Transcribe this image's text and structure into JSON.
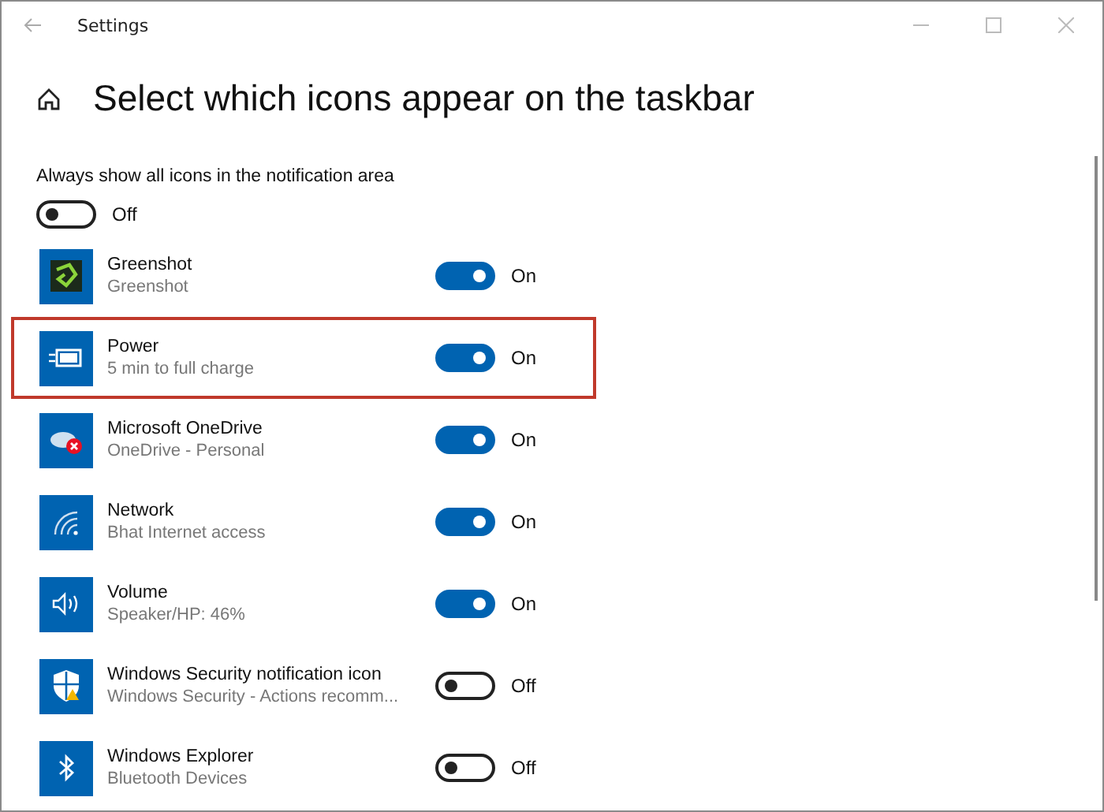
{
  "window": {
    "title": "Settings"
  },
  "page": {
    "title": "Select which icons appear on the taskbar"
  },
  "always_show": {
    "label": "Always show all icons in the notification area",
    "on": false,
    "state_text": "Off"
  },
  "apps": [
    {
      "name": "Greenshot",
      "detail": "Greenshot",
      "on": true,
      "state_text": "On",
      "highlighted": false
    },
    {
      "name": "Power",
      "detail": "5 min to full charge",
      "on": true,
      "state_text": "On",
      "highlighted": true
    },
    {
      "name": "Microsoft OneDrive",
      "detail": "OneDrive - Personal",
      "on": true,
      "state_text": "On",
      "highlighted": false
    },
    {
      "name": "Network",
      "detail": "Bhat Internet access",
      "on": true,
      "state_text": "On",
      "highlighted": false
    },
    {
      "name": "Volume",
      "detail": "Speaker/HP: 46%",
      "on": true,
      "state_text": "On",
      "highlighted": false
    },
    {
      "name": "Windows Security notification icon",
      "detail": "Windows Security - Actions recomm...",
      "on": false,
      "state_text": "Off",
      "highlighted": false
    },
    {
      "name": "Windows Explorer",
      "detail": "Bluetooth Devices",
      "on": false,
      "state_text": "Off",
      "highlighted": false
    }
  ]
}
